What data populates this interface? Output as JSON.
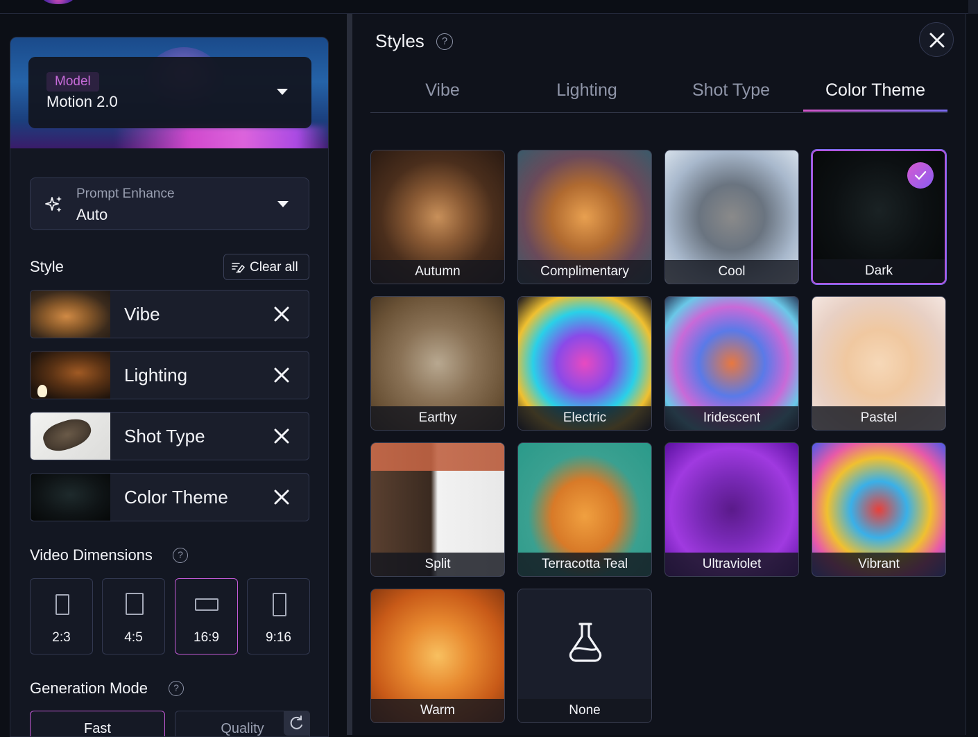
{
  "model": {
    "tag": "Model",
    "value": "Motion 2.0"
  },
  "prompt_enhance": {
    "label": "Prompt Enhance",
    "value": "Auto"
  },
  "style_section": {
    "title": "Style",
    "clear_all": "Clear all",
    "rows": [
      {
        "label": "Vibe"
      },
      {
        "label": "Lighting"
      },
      {
        "label": "Shot Type"
      },
      {
        "label": "Color Theme"
      }
    ]
  },
  "video_dimensions": {
    "title": "Video Dimensions",
    "options": [
      "2:3",
      "4:5",
      "16:9",
      "9:16"
    ],
    "selected": "16:9"
  },
  "generation_mode": {
    "title": "Generation Mode",
    "options": [
      "Fast",
      "Quality"
    ],
    "selected": "Fast"
  },
  "styles_panel": {
    "title": "Styles",
    "tabs": [
      "Vibe",
      "Lighting",
      "Shot Type",
      "Color Theme"
    ],
    "active_tab": "Color Theme",
    "themes": [
      "Autumn",
      "Complimentary",
      "Cool",
      "Dark",
      "Earthy",
      "Electric",
      "Iridescent",
      "Pastel",
      "Split",
      "Terracotta Teal",
      "Ultraviolet",
      "Vibrant",
      "Warm",
      "None"
    ],
    "selected_theme": "Dark"
  },
  "colors": {
    "accent": "#c35ad6",
    "accent2": "#7a6cf0",
    "panel": "#131722",
    "bg": "#0c0f16"
  }
}
